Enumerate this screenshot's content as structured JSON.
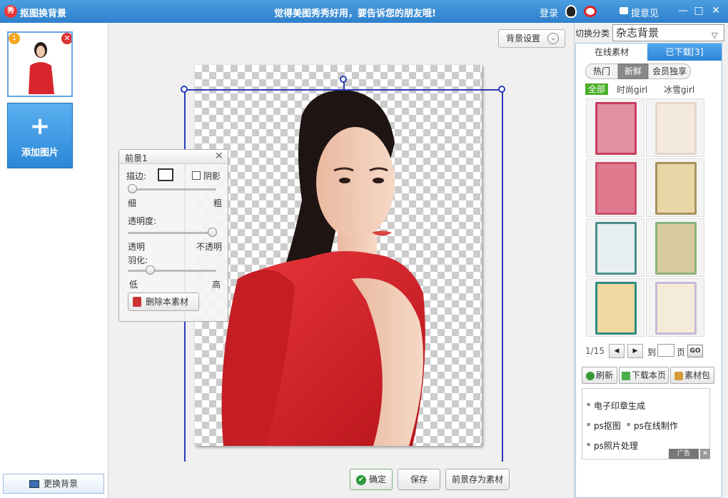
{
  "window": {
    "logo_text": "秀",
    "title": "抠图换背景",
    "slogan": "觉得美图秀秀好用，要告诉您的朋友哦!",
    "login": "登录",
    "feedback": "提意见",
    "min_symbol": "—",
    "max_symbol": "□",
    "close_symbol": "✕"
  },
  "left": {
    "thumb_badge": "1",
    "thumb_close": "✕",
    "add_plus": "+",
    "add_label": "添加图片",
    "change_bg": "更换背景"
  },
  "toolbar": {
    "bg_settings": "背景设置",
    "bg_settings_arrow": "⌄"
  },
  "fg_panel": {
    "title": "前景1",
    "close": "✕",
    "stroke_label": "描边:",
    "shadow_label": "阴影",
    "stroke_min": "细",
    "stroke_max": "粗",
    "opacity_label": "透明度:",
    "opacity_min": "透明",
    "opacity_max": "不透明",
    "feather_label": "羽化:",
    "feather_min": "低",
    "feather_max": "高",
    "delete_label": "删除本素材",
    "stroke_value": 0.05,
    "opacity_value": 0.95,
    "feather_value": 0.25
  },
  "bottom": {
    "confirm": "确定",
    "confirm_icon": "✔",
    "save": "保存",
    "save_fg": "前景存为素材"
  },
  "right": {
    "switch_label": "切换分类",
    "switch_value": "杂志背景",
    "switch_arrow": "▽",
    "tab_online": "在线素材",
    "tab_downloaded": "已下载[3]",
    "subtabs": [
      "热门",
      "新鲜",
      "会员独享"
    ],
    "filters": [
      "全部",
      "时尚girl",
      "冰雪girl"
    ],
    "pager": "1/15",
    "prev": "◀",
    "next": "▶",
    "goto": "到",
    "page_unit": "页",
    "go": "GO",
    "refresh": "刷新",
    "download_page": "下载本页",
    "material_pack": "素材包",
    "ads": [
      "电子印章生成",
      "ps抠图",
      "ps在线制作",
      "ps照片处理"
    ],
    "ad_tag": "广告",
    "ad_close": "✕"
  },
  "colors": {
    "title_bar": "#2f80cc",
    "selection": "#2a3bb8",
    "accent_green": "#4caf2a",
    "dress_red": "#d8262c"
  }
}
